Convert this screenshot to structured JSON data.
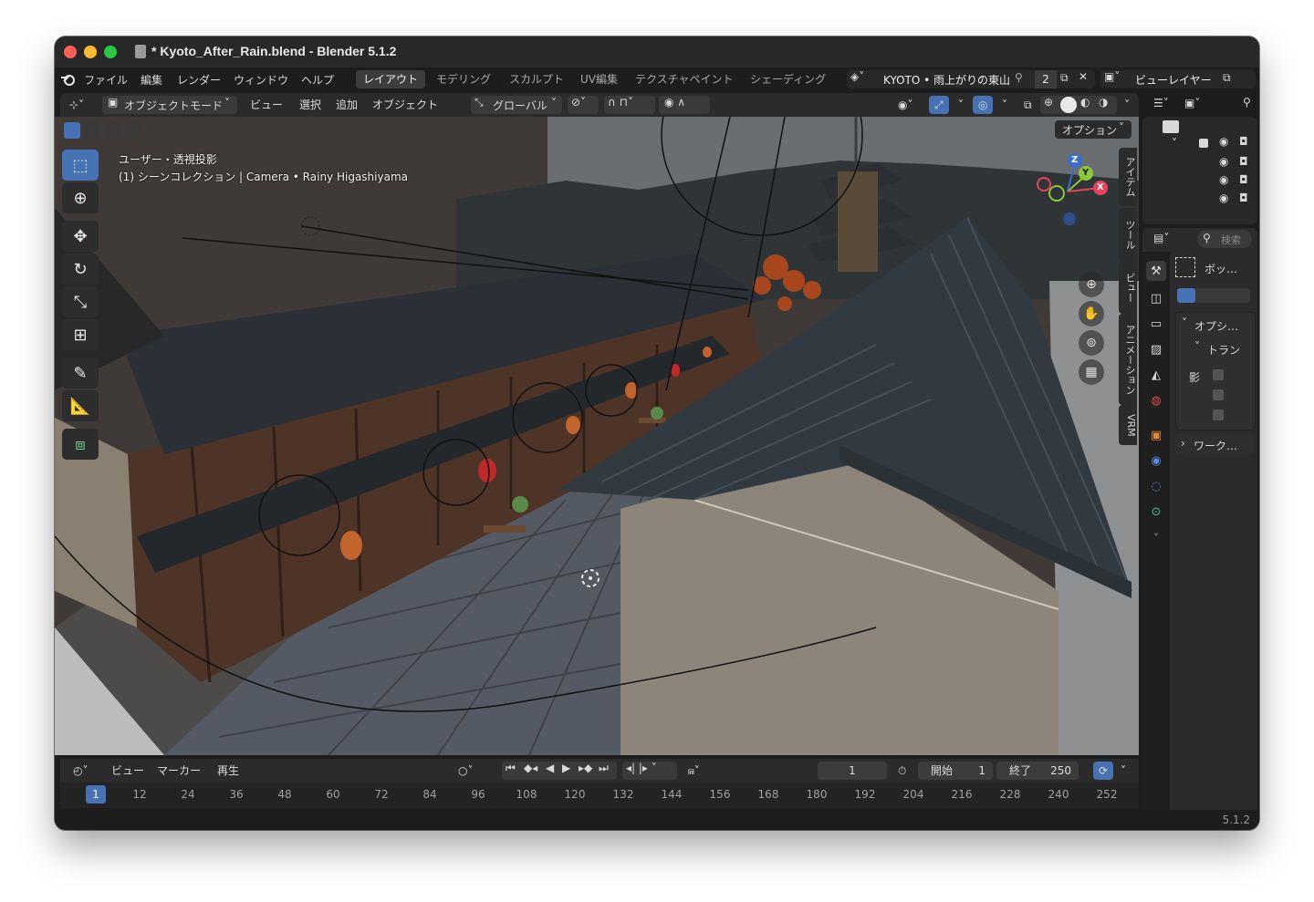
{
  "window": {
    "title": "* Kyoto_After_Rain.blend - Blender 5.1.2"
  },
  "menu": [
    "ファイル",
    "編集",
    "レンダー",
    "ウィンドウ",
    "ヘルプ"
  ],
  "workspaces": [
    "レイアウト",
    "モデリング",
    "スカルプト",
    "UV編集",
    "テクスチャペイント",
    "シェーディング"
  ],
  "scene": {
    "name": "KYOTO • 雨上がりの東山",
    "count": "2",
    "view_layer": "ビューレイヤー"
  },
  "viewport_header": {
    "mode": "オブジェクトモード",
    "items": [
      "ビュー",
      "選択",
      "追加",
      "オブジェクト"
    ],
    "orientation": "グローバル",
    "options": "オプション"
  },
  "viewport": {
    "line1": "ユーザー・透視投影",
    "line2": "(1) シーンコレクション | Camera • Rainy Higashiyama"
  },
  "gizmo_axes": {
    "z": "Z",
    "y": "Y",
    "x": "X"
  },
  "n_tabs": [
    "アイテム",
    "ツール",
    "ビュー",
    "アニメーション",
    "VRM"
  ],
  "properties": {
    "search_placeholder": "検索",
    "active_tool": "ボッ…",
    "section_options": "オプシ…",
    "section_transform": "トラン",
    "shadow_label": "影",
    "section_workspace": "ワーク…"
  },
  "timeline": {
    "items": [
      "ビュー",
      "マーカー",
      "再生"
    ],
    "current_frame": "1",
    "start_label": "開始",
    "start": "1",
    "end_label": "終了",
    "end": "250",
    "ticks": [
      "1",
      "12",
      "24",
      "36",
      "48",
      "60",
      "72",
      "84",
      "96",
      "108",
      "120",
      "132",
      "144",
      "156",
      "168",
      "180",
      "192",
      "204",
      "216",
      "228",
      "240",
      "252"
    ]
  },
  "status": {
    "version": "5.1.2"
  }
}
